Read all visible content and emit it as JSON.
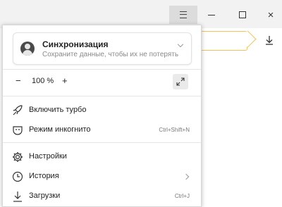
{
  "window": {
    "menu_icon": "hamburger-icon",
    "minimize_icon": "minimize-icon",
    "maximize_icon": "maximize-icon",
    "close_label": "×",
    "download_icon": "download-icon",
    "address_accent": "#f3c25a"
  },
  "sync": {
    "title": "Синхронизация",
    "subtitle": "Сохраните данные, чтобы их не потерять",
    "avatar_icon": "user-avatar-icon",
    "chevron_icon": "chevron-down-icon"
  },
  "zoom": {
    "minus_label": "−",
    "value": "100 %",
    "plus_label": "+",
    "fullscreen_icon": "fullscreen-icon"
  },
  "menu": {
    "turbo": {
      "label": "Включить турбо",
      "icon": "rocket-icon"
    },
    "incognito": {
      "label": "Режим инкогнито",
      "hotkey": "Ctrl+Shift+N",
      "icon": "incognito-mask-icon"
    },
    "settings": {
      "label": "Настройки",
      "icon": "gear-icon"
    },
    "history": {
      "label": "История",
      "icon": "clock-icon"
    },
    "downloads": {
      "label": "Загрузки",
      "hotkey": "Ctrl+J",
      "icon": "download-icon"
    }
  }
}
